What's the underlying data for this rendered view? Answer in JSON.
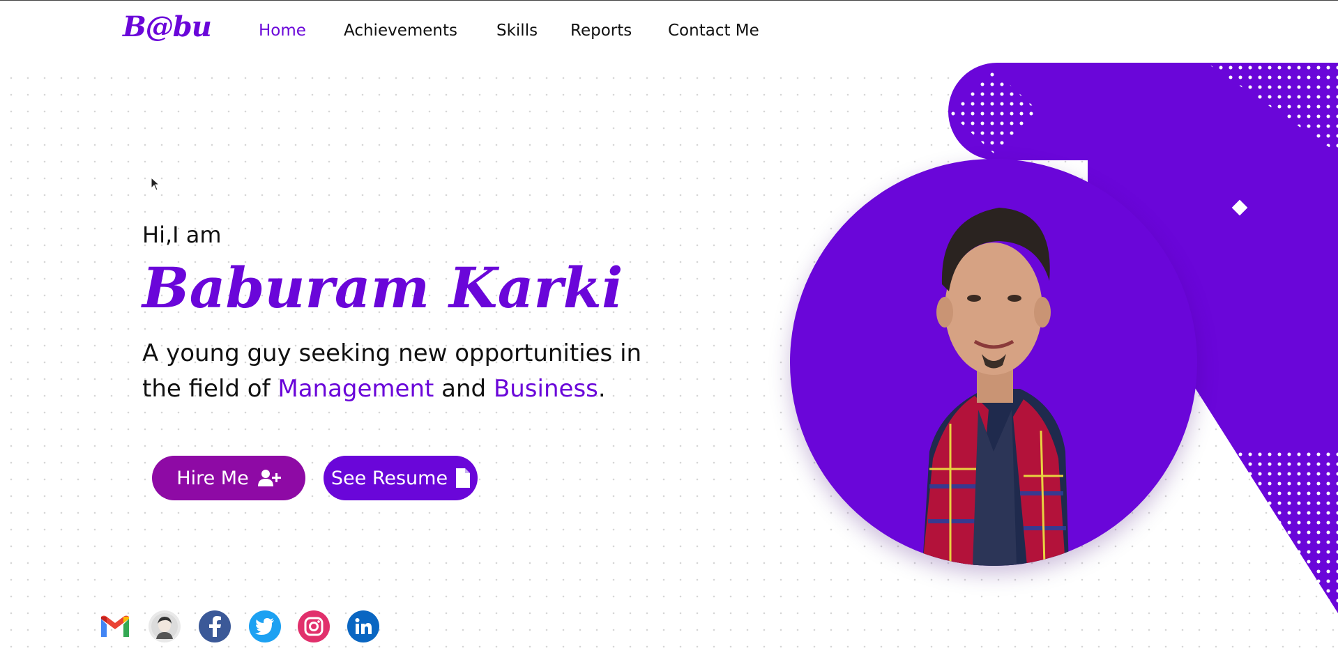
{
  "nav": {
    "logo": "B@bu",
    "items": [
      {
        "label": "Home",
        "active": true
      },
      {
        "label": "Achievements",
        "active": false
      },
      {
        "label": "Skills",
        "active": false
      },
      {
        "label": "Reports",
        "active": false
      },
      {
        "label": "Contact Me",
        "active": false
      }
    ]
  },
  "hero": {
    "greeting": "Hi,I am",
    "name": "Baburam Karki",
    "tagline_part1": "A young guy seeking new opportunities in the field of ",
    "highlight1": "Management",
    "tagline_part2": " and ",
    "highlight2": "Business",
    "tagline_end": ".",
    "hire_button": "Hire Me",
    "hire_icon": "user-plus-icon",
    "resume_button": "See Resume",
    "resume_icon": "file-icon"
  },
  "social": [
    {
      "name": "gmail-icon"
    },
    {
      "name": "avatar-icon"
    },
    {
      "name": "facebook-icon"
    },
    {
      "name": "twitter-icon"
    },
    {
      "name": "instagram-icon"
    },
    {
      "name": "linkedin-icon"
    }
  ],
  "colors": {
    "accent": "#6a06d9",
    "hire_button": "#8e0aa5",
    "facebook": "#3b5998",
    "twitter": "#1da1f2",
    "instagram": "#e1306c",
    "linkedin": "#0a66c2"
  }
}
